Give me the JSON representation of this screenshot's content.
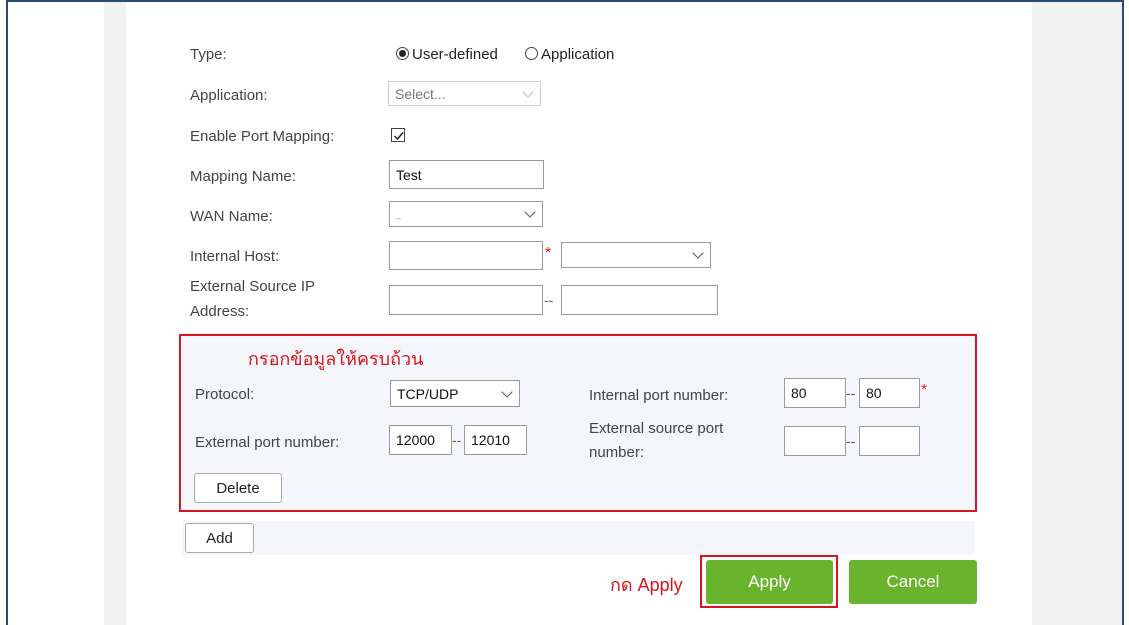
{
  "form": {
    "type_label": "Type:",
    "type_option_user": "User-defined",
    "type_option_app": "Application",
    "application_label": "Application:",
    "application_placeholder": "Select...",
    "enable_label": "Enable Port Mapping:",
    "mapping_name_label": "Mapping Name:",
    "mapping_name_value": "Test",
    "wan_name_label": "WAN Name:",
    "wan_name_value": "_",
    "internal_host_label": "Internal Host:",
    "internal_host_value": "",
    "internal_host_select_value": "",
    "ext_src_ip_label_line1": "External Source IP",
    "ext_src_ip_label_line2": "Address:",
    "ext_src_ip_start": "",
    "ext_src_ip_end": "",
    "separator": "--",
    "required_mark": "*"
  },
  "rule": {
    "protocol_label": "Protocol:",
    "protocol_value": "TCP/UDP",
    "internal_port_label": "Internal port number:",
    "internal_port_start": "80",
    "internal_port_end": "80",
    "external_port_label": "External port number:",
    "external_port_start": "12000",
    "external_port_end": "12010",
    "ext_src_port_label_line1": "External source port",
    "ext_src_port_label_line2": "number:",
    "ext_src_port_start": "",
    "ext_src_port_end": "",
    "delete_label": "Delete"
  },
  "actions": {
    "add_label": "Add",
    "apply_label": "Apply",
    "cancel_label": "Cancel"
  },
  "annotations": {
    "fill_all": "กรอกข้อมูลให้ครบถ้วน",
    "press_apply": "กด Apply"
  },
  "colors": {
    "accent_green": "#6ab42d",
    "annotation_red": "#d9141c"
  }
}
